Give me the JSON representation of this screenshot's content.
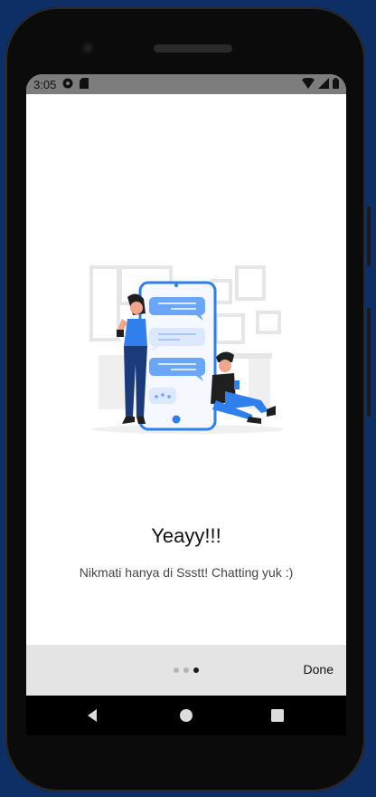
{
  "status_bar": {
    "time": "3:05",
    "left_icons": [
      "vpn-key-icon",
      "sd-card-icon"
    ],
    "right_icons": [
      "wifi-icon",
      "signal-icon",
      "battery-icon"
    ]
  },
  "onboarding": {
    "title": "Yeayy!!!",
    "subtitle": "Nikmati hanya di Ssstt! Chatting yuk :)",
    "page_indicator": {
      "count": 3,
      "active_index": 2
    },
    "done_label": "Done"
  },
  "navbar": {
    "buttons": [
      "back-icon",
      "home-icon",
      "recents-icon"
    ]
  },
  "colors": {
    "accent": "#2f80ed",
    "bubble": "#6aa6f8",
    "bottom_bar": "#e4e4e4",
    "status_bar": "#7d7d7d"
  }
}
